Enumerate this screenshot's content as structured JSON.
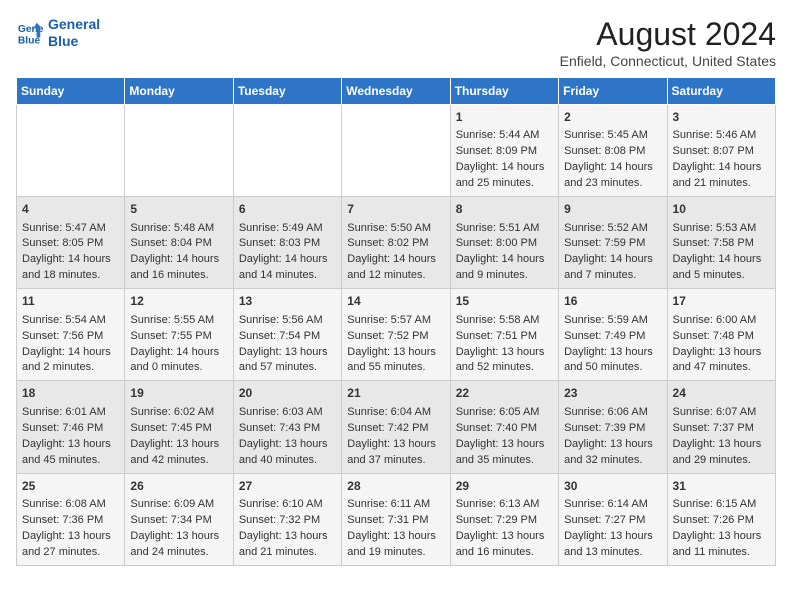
{
  "header": {
    "logo_line1": "General",
    "logo_line2": "Blue",
    "main_title": "August 2024",
    "subtitle": "Enfield, Connecticut, United States"
  },
  "days_of_week": [
    "Sunday",
    "Monday",
    "Tuesday",
    "Wednesday",
    "Thursday",
    "Friday",
    "Saturday"
  ],
  "weeks": [
    [
      {
        "day": "",
        "info": ""
      },
      {
        "day": "",
        "info": ""
      },
      {
        "day": "",
        "info": ""
      },
      {
        "day": "",
        "info": ""
      },
      {
        "day": "1",
        "info": "Sunrise: 5:44 AM\nSunset: 8:09 PM\nDaylight: 14 hours\nand 25 minutes."
      },
      {
        "day": "2",
        "info": "Sunrise: 5:45 AM\nSunset: 8:08 PM\nDaylight: 14 hours\nand 23 minutes."
      },
      {
        "day": "3",
        "info": "Sunrise: 5:46 AM\nSunset: 8:07 PM\nDaylight: 14 hours\nand 21 minutes."
      }
    ],
    [
      {
        "day": "4",
        "info": "Sunrise: 5:47 AM\nSunset: 8:05 PM\nDaylight: 14 hours\nand 18 minutes."
      },
      {
        "day": "5",
        "info": "Sunrise: 5:48 AM\nSunset: 8:04 PM\nDaylight: 14 hours\nand 16 minutes."
      },
      {
        "day": "6",
        "info": "Sunrise: 5:49 AM\nSunset: 8:03 PM\nDaylight: 14 hours\nand 14 minutes."
      },
      {
        "day": "7",
        "info": "Sunrise: 5:50 AM\nSunset: 8:02 PM\nDaylight: 14 hours\nand 12 minutes."
      },
      {
        "day": "8",
        "info": "Sunrise: 5:51 AM\nSunset: 8:00 PM\nDaylight: 14 hours\nand 9 minutes."
      },
      {
        "day": "9",
        "info": "Sunrise: 5:52 AM\nSunset: 7:59 PM\nDaylight: 14 hours\nand 7 minutes."
      },
      {
        "day": "10",
        "info": "Sunrise: 5:53 AM\nSunset: 7:58 PM\nDaylight: 14 hours\nand 5 minutes."
      }
    ],
    [
      {
        "day": "11",
        "info": "Sunrise: 5:54 AM\nSunset: 7:56 PM\nDaylight: 14 hours\nand 2 minutes."
      },
      {
        "day": "12",
        "info": "Sunrise: 5:55 AM\nSunset: 7:55 PM\nDaylight: 14 hours\nand 0 minutes."
      },
      {
        "day": "13",
        "info": "Sunrise: 5:56 AM\nSunset: 7:54 PM\nDaylight: 13 hours\nand 57 minutes."
      },
      {
        "day": "14",
        "info": "Sunrise: 5:57 AM\nSunset: 7:52 PM\nDaylight: 13 hours\nand 55 minutes."
      },
      {
        "day": "15",
        "info": "Sunrise: 5:58 AM\nSunset: 7:51 PM\nDaylight: 13 hours\nand 52 minutes."
      },
      {
        "day": "16",
        "info": "Sunrise: 5:59 AM\nSunset: 7:49 PM\nDaylight: 13 hours\nand 50 minutes."
      },
      {
        "day": "17",
        "info": "Sunrise: 6:00 AM\nSunset: 7:48 PM\nDaylight: 13 hours\nand 47 minutes."
      }
    ],
    [
      {
        "day": "18",
        "info": "Sunrise: 6:01 AM\nSunset: 7:46 PM\nDaylight: 13 hours\nand 45 minutes."
      },
      {
        "day": "19",
        "info": "Sunrise: 6:02 AM\nSunset: 7:45 PM\nDaylight: 13 hours\nand 42 minutes."
      },
      {
        "day": "20",
        "info": "Sunrise: 6:03 AM\nSunset: 7:43 PM\nDaylight: 13 hours\nand 40 minutes."
      },
      {
        "day": "21",
        "info": "Sunrise: 6:04 AM\nSunset: 7:42 PM\nDaylight: 13 hours\nand 37 minutes."
      },
      {
        "day": "22",
        "info": "Sunrise: 6:05 AM\nSunset: 7:40 PM\nDaylight: 13 hours\nand 35 minutes."
      },
      {
        "day": "23",
        "info": "Sunrise: 6:06 AM\nSunset: 7:39 PM\nDaylight: 13 hours\nand 32 minutes."
      },
      {
        "day": "24",
        "info": "Sunrise: 6:07 AM\nSunset: 7:37 PM\nDaylight: 13 hours\nand 29 minutes."
      }
    ],
    [
      {
        "day": "25",
        "info": "Sunrise: 6:08 AM\nSunset: 7:36 PM\nDaylight: 13 hours\nand 27 minutes."
      },
      {
        "day": "26",
        "info": "Sunrise: 6:09 AM\nSunset: 7:34 PM\nDaylight: 13 hours\nand 24 minutes."
      },
      {
        "day": "27",
        "info": "Sunrise: 6:10 AM\nSunset: 7:32 PM\nDaylight: 13 hours\nand 21 minutes."
      },
      {
        "day": "28",
        "info": "Sunrise: 6:11 AM\nSunset: 7:31 PM\nDaylight: 13 hours\nand 19 minutes."
      },
      {
        "day": "29",
        "info": "Sunrise: 6:13 AM\nSunset: 7:29 PM\nDaylight: 13 hours\nand 16 minutes."
      },
      {
        "day": "30",
        "info": "Sunrise: 6:14 AM\nSunset: 7:27 PM\nDaylight: 13 hours\nand 13 minutes."
      },
      {
        "day": "31",
        "info": "Sunrise: 6:15 AM\nSunset: 7:26 PM\nDaylight: 13 hours\nand 11 minutes."
      }
    ]
  ]
}
